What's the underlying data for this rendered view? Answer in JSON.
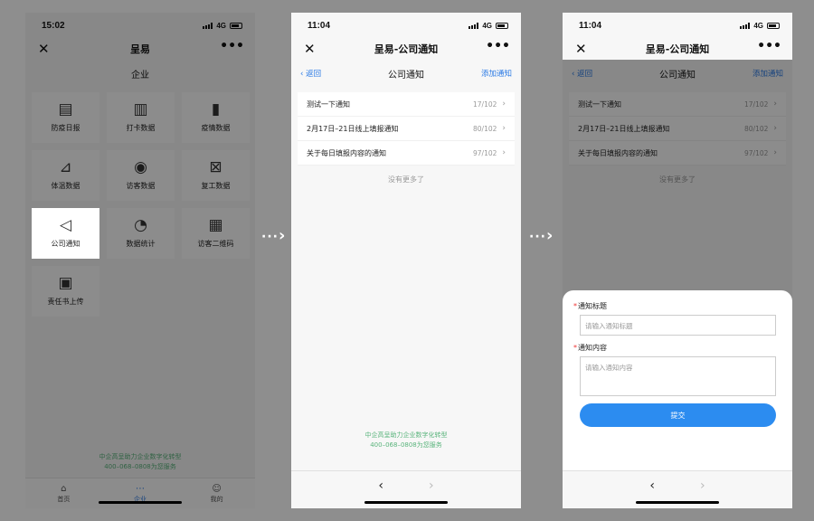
{
  "screen1": {
    "time": "15:02",
    "network": "4G",
    "title": "呈易",
    "subtitle": "企业",
    "tiles": [
      {
        "label": "防疫日报",
        "icon": "▤"
      },
      {
        "label": "打卡数据",
        "icon": "▥"
      },
      {
        "label": "疫情数据",
        "icon": "▮"
      },
      {
        "label": "体温数据",
        "icon": "⊿"
      },
      {
        "label": "访客数据",
        "icon": "◉"
      },
      {
        "label": "复工数据",
        "icon": "⊠"
      },
      {
        "label": "公司通知",
        "icon": "◁"
      },
      {
        "label": "数据统计",
        "icon": "◔"
      },
      {
        "label": "访客二维码",
        "icon": "▦"
      },
      {
        "label": "责任书上传",
        "icon": "▣"
      }
    ],
    "footer_line1": "中企高呈助力企业数字化转型",
    "footer_line2": "400–068–0808为您服务",
    "tabs": [
      {
        "label": "首页",
        "icon": "⌂"
      },
      {
        "label": "企业",
        "icon": "⋯"
      },
      {
        "label": "我的",
        "icon": "☺"
      }
    ]
  },
  "screen2": {
    "time": "11:04",
    "network": "4G",
    "title": "呈易-公司通知",
    "back": "返回",
    "page_title": "公司通知",
    "add": "添加通知",
    "notices": [
      {
        "title": "测试一下通知",
        "count": "17/102"
      },
      {
        "title": "2月17日–21日线上填报通知",
        "count": "80/102"
      },
      {
        "title": "关于每日填报内容的通知",
        "count": "97/102"
      }
    ],
    "no_more": "没有更多了",
    "footer_line1": "中企高呈助力企业数字化转型",
    "footer_line2": "400–068–0808为您服务"
  },
  "screen3": {
    "time": "11:04",
    "network": "4G",
    "title": "呈易-公司通知",
    "back": "返回",
    "page_title": "公司通知",
    "add": "添加通知",
    "notices": [
      {
        "title": "测试一下通知",
        "count": "17/102"
      },
      {
        "title": "2月17日–21日线上填报通知",
        "count": "80/102"
      },
      {
        "title": "关于每日填报内容的通知",
        "count": "97/102"
      }
    ],
    "no_more": "没有更多了",
    "form": {
      "title_label": "通知标题",
      "title_placeholder": "请输入通知标题",
      "content_label": "通知内容",
      "content_placeholder": "请输入通知内容",
      "submit": "提交"
    }
  },
  "colors": {
    "accent": "#2c7be5",
    "footer_green": "#5ab47c",
    "required": "#e33333"
  }
}
